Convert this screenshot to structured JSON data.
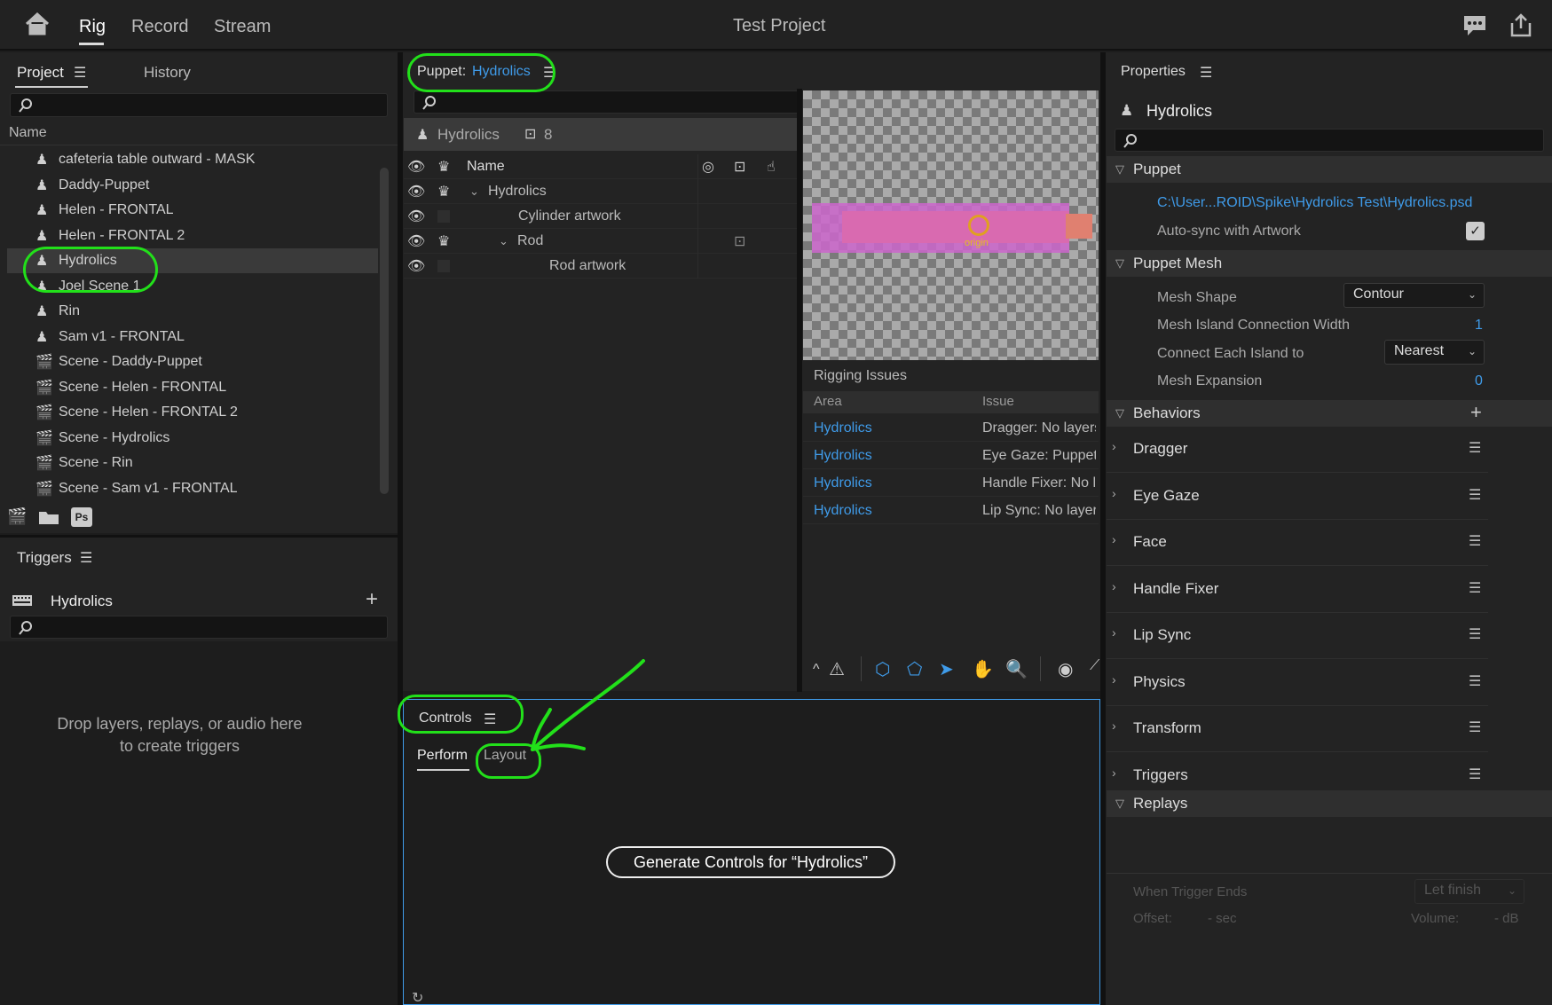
{
  "app": {
    "title": "Test Project"
  },
  "top_tabs": {
    "rig": "Rig",
    "record": "Record",
    "stream": "Stream"
  },
  "project_panel": {
    "tab_project": "Project",
    "tab_history": "History",
    "column_name": "Name",
    "items": [
      {
        "label": "cafeteria table outward - MASK",
        "type": "puppet"
      },
      {
        "label": "Daddy-Puppet",
        "type": "puppet"
      },
      {
        "label": "Helen - FRONTAL",
        "type": "puppet"
      },
      {
        "label": "Helen - FRONTAL 2",
        "type": "puppet"
      },
      {
        "label": "Hydrolics",
        "type": "puppet",
        "selected": true
      },
      {
        "label": "Joel Scene 1",
        "type": "puppet"
      },
      {
        "label": "Rin",
        "type": "puppet"
      },
      {
        "label": "Sam v1 - FRONTAL",
        "type": "puppet"
      },
      {
        "label": "Scene - Daddy-Puppet",
        "type": "scene"
      },
      {
        "label": "Scene - Helen - FRONTAL",
        "type": "scene"
      },
      {
        "label": "Scene - Helen - FRONTAL 2",
        "type": "scene"
      },
      {
        "label": "Scene - Hydrolics",
        "type": "scene"
      },
      {
        "label": "Scene - Rin",
        "type": "scene"
      },
      {
        "label": "Scene - Sam v1 - FRONTAL",
        "type": "scene"
      }
    ],
    "ps_badge": "Ps"
  },
  "triggers_panel": {
    "title": "Triggers",
    "puppet_name": "Hydrolics",
    "empty_line1": "Drop layers, replays, or audio here",
    "empty_line2": "to create triggers"
  },
  "puppet_panel": {
    "title_prefix": "Puppet:",
    "puppet_name": "Hydrolics",
    "header_name": "Hydrolics",
    "handle_count": "8",
    "column_name": "Name",
    "layers": [
      {
        "label": "Hydrolics"
      },
      {
        "label": "Cylinder artwork"
      },
      {
        "label": "Rod"
      },
      {
        "label": "Rod artwork"
      }
    ],
    "origin_label": "origin"
  },
  "rigging_issues": {
    "title": "Rigging Issues",
    "col_area": "Area",
    "col_issue": "Issue",
    "rows": [
      {
        "area": "Hydrolics",
        "issue": "Dragger: No layers"
      },
      {
        "area": "Hydrolics",
        "issue": "Eye Gaze: Puppet"
      },
      {
        "area": "Hydrolics",
        "issue": "Handle Fixer: No l"
      },
      {
        "area": "Hydrolics",
        "issue": "Lip Sync: No layer"
      }
    ]
  },
  "controls_panel": {
    "title": "Controls",
    "tab_perform": "Perform",
    "tab_layout": "Layout",
    "generate_button": "Generate Controls for “Hydrolics”"
  },
  "properties": {
    "title": "Properties",
    "puppet_name": "Hydrolics",
    "section_puppet": "Puppet",
    "file_path": "C:\\User...ROID\\Spike\\Hydrolics Test\\Hydrolics.psd",
    "autosync_label": "Auto-sync with Artwork",
    "section_mesh": "Puppet Mesh",
    "mesh_shape_label": "Mesh Shape",
    "mesh_shape_value": "Contour",
    "island_width_label": "Mesh Island Connection Width",
    "island_width_value": "1",
    "connect_label": "Connect Each Island to",
    "connect_value": "Nearest",
    "expansion_label": "Mesh Expansion",
    "expansion_value": "0",
    "section_behaviors": "Behaviors",
    "behaviors": [
      "Dragger",
      "Eye Gaze",
      "Face",
      "Handle Fixer",
      "Lip Sync",
      "Physics",
      "Transform",
      "Triggers"
    ],
    "section_replays": "Replays",
    "when_trigger_label": "When Trigger Ends",
    "when_trigger_value": "Let finish",
    "offset_label": "Offset:",
    "offset_value": "- sec",
    "volume_label": "Volume:",
    "volume_value": "- dB"
  },
  "colors": {
    "accent": "#3f9be9",
    "annotation": "#22e01a",
    "background": "#1d1d1d"
  }
}
